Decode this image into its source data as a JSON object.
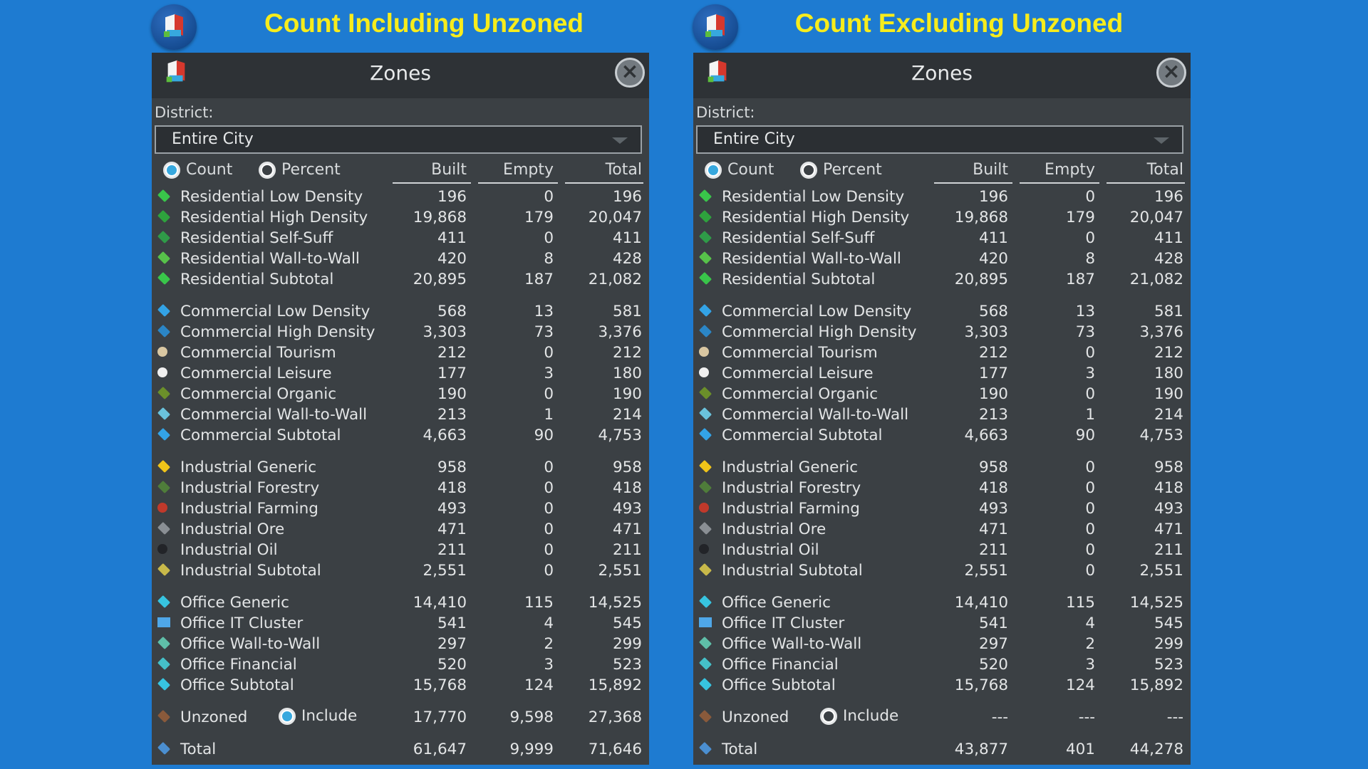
{
  "left": {
    "headline": "Count Including Unzoned",
    "title": "Zones",
    "district_label": "District:",
    "district_value": "Entire City",
    "radio_count": "Count",
    "radio_percent": "Percent",
    "col_built": "Built",
    "col_empty": "Empty",
    "col_total": "Total",
    "include_label": "Include",
    "rows": [
      {
        "name": "Residential Low Density",
        "built": "196",
        "empty": "0",
        "total": "196"
      },
      {
        "name": "Residential High Density",
        "built": "19,868",
        "empty": "179",
        "total": "20,047"
      },
      {
        "name": "Residential Self-Suff",
        "built": "411",
        "empty": "0",
        "total": "411"
      },
      {
        "name": "Residential Wall-to-Wall",
        "built": "420",
        "empty": "8",
        "total": "428"
      },
      {
        "name": "Residential Subtotal",
        "built": "20,895",
        "empty": "187",
        "total": "21,082"
      },
      {
        "name": "Commercial Low Density",
        "built": "568",
        "empty": "13",
        "total": "581"
      },
      {
        "name": "Commercial High Density",
        "built": "3,303",
        "empty": "73",
        "total": "3,376"
      },
      {
        "name": "Commercial Tourism",
        "built": "212",
        "empty": "0",
        "total": "212"
      },
      {
        "name": "Commercial Leisure",
        "built": "177",
        "empty": "3",
        "total": "180"
      },
      {
        "name": "Commercial Organic",
        "built": "190",
        "empty": "0",
        "total": "190"
      },
      {
        "name": "Commercial Wall-to-Wall",
        "built": "213",
        "empty": "1",
        "total": "214"
      },
      {
        "name": "Commercial Subtotal",
        "built": "4,663",
        "empty": "90",
        "total": "4,753"
      },
      {
        "name": "Industrial Generic",
        "built": "958",
        "empty": "0",
        "total": "958"
      },
      {
        "name": "Industrial Forestry",
        "built": "418",
        "empty": "0",
        "total": "418"
      },
      {
        "name": "Industrial Farming",
        "built": "493",
        "empty": "0",
        "total": "493"
      },
      {
        "name": "Industrial Ore",
        "built": "471",
        "empty": "0",
        "total": "471"
      },
      {
        "name": "Industrial Oil",
        "built": "211",
        "empty": "0",
        "total": "211"
      },
      {
        "name": "Industrial Subtotal",
        "built": "2,551",
        "empty": "0",
        "total": "2,551"
      },
      {
        "name": "Office Generic",
        "built": "14,410",
        "empty": "115",
        "total": "14,525"
      },
      {
        "name": "Office IT Cluster",
        "built": "541",
        "empty": "4",
        "total": "545"
      },
      {
        "name": "Office Wall-to-Wall",
        "built": "297",
        "empty": "2",
        "total": "299"
      },
      {
        "name": "Office Financial",
        "built": "520",
        "empty": "3",
        "total": "523"
      },
      {
        "name": "Office Subtotal",
        "built": "15,768",
        "empty": "124",
        "total": "15,892"
      },
      {
        "name": "Unzoned",
        "built": "17,770",
        "empty": "9,598",
        "total": "27,368"
      },
      {
        "name": "Total",
        "built": "61,647",
        "empty": "9,999",
        "total": "71,646"
      }
    ]
  },
  "right": {
    "headline": "Count Excluding Unzoned",
    "title": "Zones",
    "district_label": "District:",
    "district_value": "Entire City",
    "radio_count": "Count",
    "radio_percent": "Percent",
    "col_built": "Built",
    "col_empty": "Empty",
    "col_total": "Total",
    "include_label": "Include",
    "rows": [
      {
        "name": "Residential Low Density",
        "built": "196",
        "empty": "0",
        "total": "196"
      },
      {
        "name": "Residential High Density",
        "built": "19,868",
        "empty": "179",
        "total": "20,047"
      },
      {
        "name": "Residential Self-Suff",
        "built": "411",
        "empty": "0",
        "total": "411"
      },
      {
        "name": "Residential Wall-to-Wall",
        "built": "420",
        "empty": "8",
        "total": "428"
      },
      {
        "name": "Residential Subtotal",
        "built": "20,895",
        "empty": "187",
        "total": "21,082"
      },
      {
        "name": "Commercial Low Density",
        "built": "568",
        "empty": "13",
        "total": "581"
      },
      {
        "name": "Commercial High Density",
        "built": "3,303",
        "empty": "73",
        "total": "3,376"
      },
      {
        "name": "Commercial Tourism",
        "built": "212",
        "empty": "0",
        "total": "212"
      },
      {
        "name": "Commercial Leisure",
        "built": "177",
        "empty": "3",
        "total": "180"
      },
      {
        "name": "Commercial Organic",
        "built": "190",
        "empty": "0",
        "total": "190"
      },
      {
        "name": "Commercial Wall-to-Wall",
        "built": "213",
        "empty": "1",
        "total": "214"
      },
      {
        "name": "Commercial Subtotal",
        "built": "4,663",
        "empty": "90",
        "total": "4,753"
      },
      {
        "name": "Industrial Generic",
        "built": "958",
        "empty": "0",
        "total": "958"
      },
      {
        "name": "Industrial Forestry",
        "built": "418",
        "empty": "0",
        "total": "418"
      },
      {
        "name": "Industrial Farming",
        "built": "493",
        "empty": "0",
        "total": "493"
      },
      {
        "name": "Industrial Ore",
        "built": "471",
        "empty": "0",
        "total": "471"
      },
      {
        "name": "Industrial Oil",
        "built": "211",
        "empty": "0",
        "total": "211"
      },
      {
        "name": "Industrial Subtotal",
        "built": "2,551",
        "empty": "0",
        "total": "2,551"
      },
      {
        "name": "Office Generic",
        "built": "14,410",
        "empty": "115",
        "total": "14,525"
      },
      {
        "name": "Office IT Cluster",
        "built": "541",
        "empty": "4",
        "total": "545"
      },
      {
        "name": "Office Wall-to-Wall",
        "built": "297",
        "empty": "2",
        "total": "299"
      },
      {
        "name": "Office Financial",
        "built": "520",
        "empty": "3",
        "total": "523"
      },
      {
        "name": "Office Subtotal",
        "built": "15,768",
        "empty": "124",
        "total": "15,892"
      },
      {
        "name": "Unzoned",
        "built": "---",
        "empty": "---",
        "total": "---"
      },
      {
        "name": "Total",
        "built": "43,877",
        "empty": "401",
        "total": "44,278"
      }
    ]
  },
  "colors": {
    "background": "#1e7bd1",
    "headline": "#f7ec1c",
    "panel": "#3b4044",
    "accent_radio": "#37a8de"
  }
}
